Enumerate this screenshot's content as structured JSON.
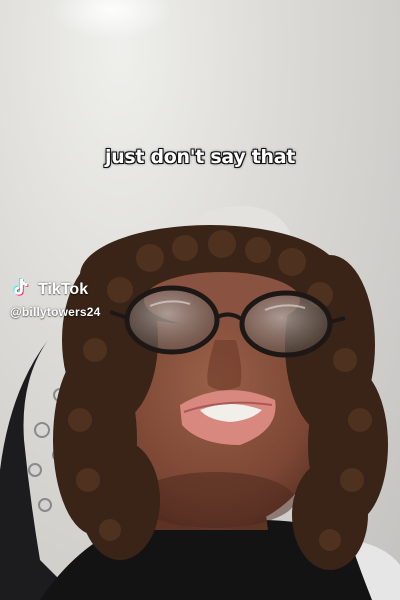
{
  "video": {
    "caption": "just don't say that"
  },
  "watermark": {
    "logo_icon": "tiktok-note-icon",
    "brand": "TikTok",
    "handle": "@billytowers24"
  },
  "colors": {
    "caption_text": "#ffffff",
    "caption_outline": "#111111",
    "wall": "#d9d8d4",
    "tiktok_cyan": "#25f4ee",
    "tiktok_red": "#fe2c55"
  }
}
